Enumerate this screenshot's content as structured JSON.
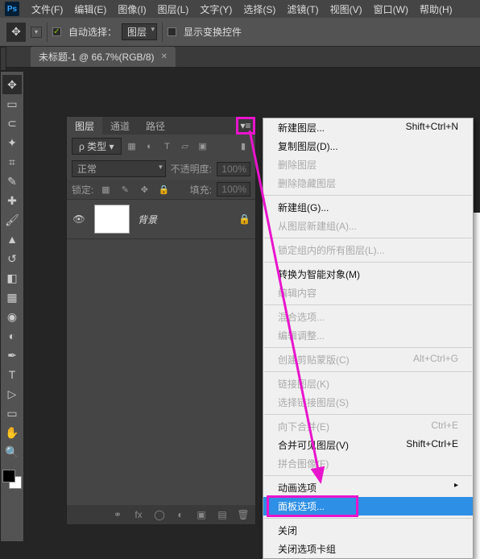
{
  "menubar": {
    "items": [
      "文件(F)",
      "编辑(E)",
      "图像(I)",
      "图层(L)",
      "文字(Y)",
      "选择(S)",
      "滤镜(T)",
      "视图(V)",
      "窗口(W)",
      "帮助(H)"
    ]
  },
  "optionsbar": {
    "auto_select_label": "自动选择：",
    "auto_select_target": "图层",
    "show_transform_label": "显示变换控件"
  },
  "doc_tab": {
    "title": "未标题-1 @ 66.7%(RGB/8)"
  },
  "layers_panel": {
    "tabs": [
      "图层",
      "通道",
      "路径"
    ],
    "kind_label": "类型",
    "blend_mode": "正常",
    "opacity_label": "不透明度:",
    "opacity_value": "100%",
    "lock_label": "锁定:",
    "fill_label": "填充:",
    "fill_value": "100%",
    "layer": {
      "name": "背景"
    }
  },
  "ctx_menu": {
    "items": [
      {
        "label": "新建图层...",
        "shortcut": "Shift+Ctrl+N",
        "enabled": true
      },
      {
        "label": "复制图层(D)...",
        "shortcut": "",
        "enabled": true
      },
      {
        "label": "删除图层",
        "shortcut": "",
        "enabled": false
      },
      {
        "label": "删除隐藏图层",
        "shortcut": "",
        "enabled": false
      },
      {
        "sep": true
      },
      {
        "label": "新建组(G)...",
        "shortcut": "",
        "enabled": true
      },
      {
        "label": "从图层新建组(A)...",
        "shortcut": "",
        "enabled": false
      },
      {
        "sep": true
      },
      {
        "label": "锁定组内的所有图层(L)...",
        "shortcut": "",
        "enabled": false
      },
      {
        "sep": true
      },
      {
        "label": "转换为智能对象(M)",
        "shortcut": "",
        "enabled": true
      },
      {
        "label": "编辑内容",
        "shortcut": "",
        "enabled": false
      },
      {
        "sep": true
      },
      {
        "label": "混合选项...",
        "shortcut": "",
        "enabled": false
      },
      {
        "label": "编辑调整...",
        "shortcut": "",
        "enabled": false
      },
      {
        "sep": true
      },
      {
        "label": "创建剪贴蒙版(C)",
        "shortcut": "Alt+Ctrl+G",
        "enabled": false
      },
      {
        "sep": true
      },
      {
        "label": "链接图层(K)",
        "shortcut": "",
        "enabled": false
      },
      {
        "label": "选择链接图层(S)",
        "shortcut": "",
        "enabled": false
      },
      {
        "sep": true
      },
      {
        "label": "向下合并(E)",
        "shortcut": "Ctrl+E",
        "enabled": false
      },
      {
        "label": "合并可见图层(V)",
        "shortcut": "Shift+Ctrl+E",
        "enabled": true
      },
      {
        "label": "拼合图像(F)",
        "shortcut": "",
        "enabled": false
      },
      {
        "sep": true
      },
      {
        "label": "动画选项",
        "shortcut": "",
        "enabled": true,
        "submenu": true
      },
      {
        "label": "面板选项...",
        "shortcut": "",
        "enabled": true,
        "highlight": true
      },
      {
        "sep": true
      },
      {
        "label": "关闭",
        "shortcut": "",
        "enabled": true
      },
      {
        "label": "关闭选项卡组",
        "shortcut": "",
        "enabled": true
      }
    ]
  },
  "colors": {
    "highlight_pink": "#e815cc",
    "menu_highlight": "#2e8fe6"
  }
}
